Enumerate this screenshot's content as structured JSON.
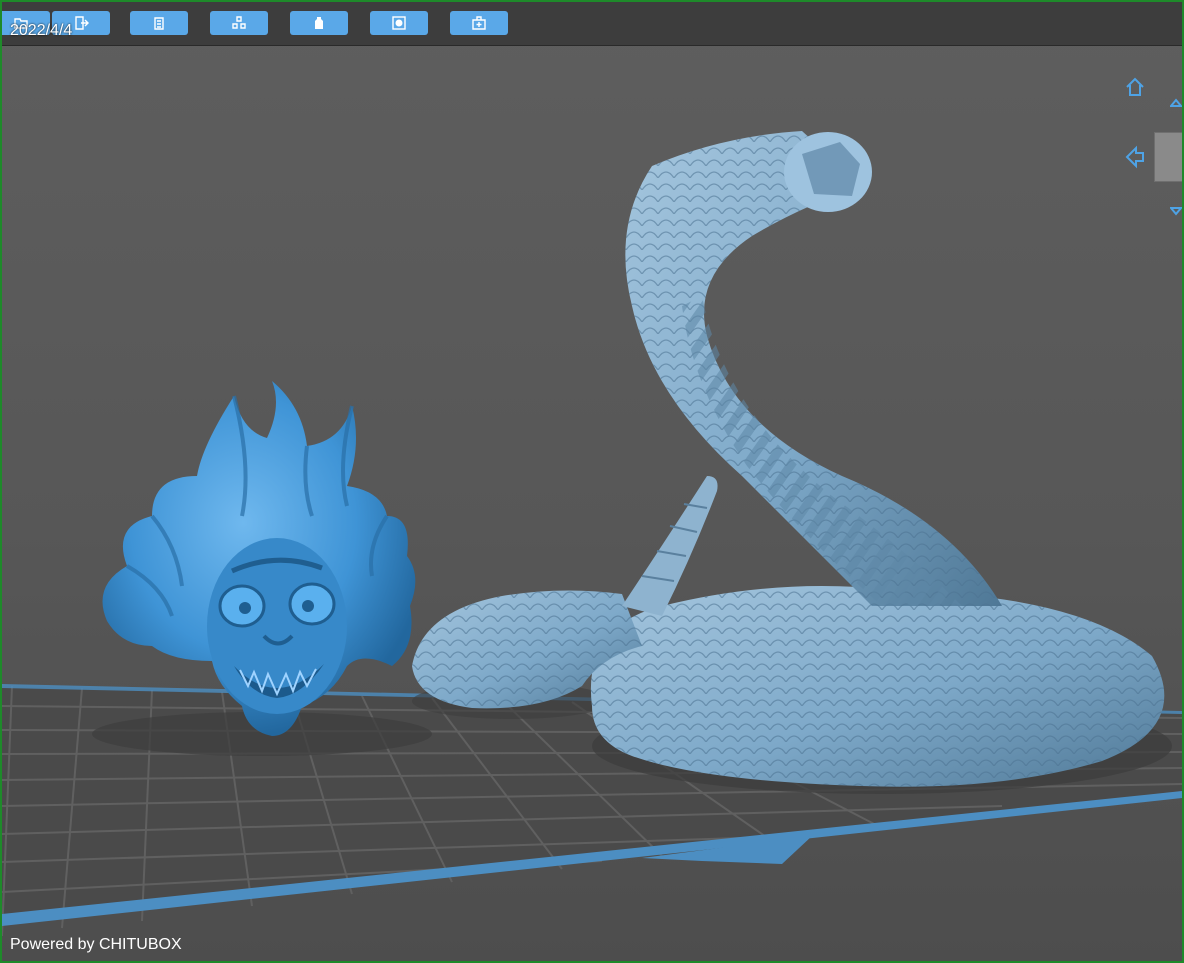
{
  "viewport": {
    "date": "2022/4/4",
    "watermark": "Powered by CHITUBOX"
  },
  "toolbar": {
    "buttons": [
      {
        "name": "open-file-button",
        "icon": "open-file-icon"
      },
      {
        "name": "export-button",
        "icon": "export-icon"
      },
      {
        "name": "copy-button",
        "icon": "copy-icon"
      },
      {
        "name": "arrange-button",
        "icon": "arrange-icon"
      },
      {
        "name": "support-button",
        "icon": "support-icon"
      },
      {
        "name": "hollow-button",
        "icon": "hollow-icon"
      },
      {
        "name": "add-hole-button",
        "icon": "add-hole-icon"
      }
    ]
  },
  "view_controls": {
    "icons": [
      "home-view-icon",
      "left-view-icon",
      "top-view-icon",
      "bottom-view-icon"
    ]
  },
  "colors": {
    "toolbar_button": "#5aa8e8",
    "model_head": "#3f94d6",
    "model_snake": "#7ea9c9",
    "platform_edge": "#4c8ec2",
    "frame_border": "#1e8a2a"
  }
}
